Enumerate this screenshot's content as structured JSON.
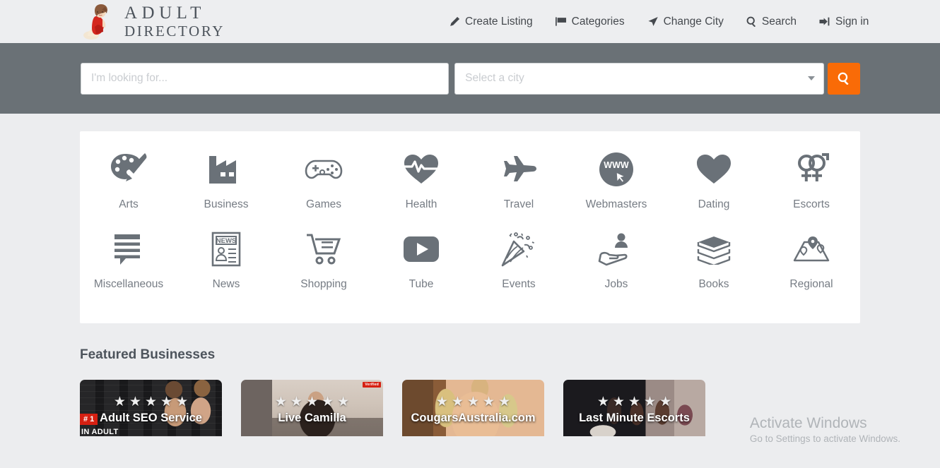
{
  "site": {
    "logo_line1": "ADULT",
    "logo_line2": "DIRECTORY"
  },
  "nav": {
    "items": [
      {
        "label": "Create Listing",
        "icon": "pencil-icon"
      },
      {
        "label": "Categories",
        "icon": "flag-icon"
      },
      {
        "label": "Change City",
        "icon": "location-arrow-icon"
      },
      {
        "label": "Search",
        "icon": "search-icon"
      },
      {
        "label": "Sign in",
        "icon": "sign-in-icon"
      }
    ]
  },
  "search": {
    "query_value": "",
    "query_placeholder": "I'm looking for...",
    "city_value": "Select a city",
    "submit_icon": "search-icon",
    "band_color": "#6a7176",
    "button_color": "#f96b07"
  },
  "categories": {
    "row1": [
      {
        "label": "Arts",
        "icon": "palette-icon"
      },
      {
        "label": "Business",
        "icon": "factory-icon"
      },
      {
        "label": "Games",
        "icon": "gamepad-icon"
      },
      {
        "label": "Health",
        "icon": "heartbeat-icon"
      },
      {
        "label": "Travel",
        "icon": "airplane-icon"
      },
      {
        "label": "Webmasters",
        "icon": "www-circle-icon"
      },
      {
        "label": "Dating",
        "icon": "heart-icon"
      },
      {
        "label": "Escorts",
        "icon": "gender-symbols-icon"
      }
    ],
    "row2": [
      {
        "label": "Miscellaneous",
        "icon": "speech-bubble-icon"
      },
      {
        "label": "News",
        "icon": "newspaper-icon"
      },
      {
        "label": "Shopping",
        "icon": "shopping-cart-icon"
      },
      {
        "label": "Tube",
        "icon": "play-button-icon"
      },
      {
        "label": "Events",
        "icon": "party-popper-icon"
      },
      {
        "label": "Jobs",
        "icon": "hand-person-icon"
      },
      {
        "label": "Books",
        "icon": "books-stack-icon"
      },
      {
        "label": "Regional",
        "icon": "map-pins-icon"
      }
    ]
  },
  "featured": {
    "heading": "Featured Businesses",
    "cards": [
      {
        "name": "Adult SEO Service",
        "rating": 5,
        "rank_badge": "# 1",
        "sub_badge": "IN ADULT",
        "corner_badge": ""
      },
      {
        "name": "Live Camilla",
        "rating": 5,
        "rank_badge": "",
        "sub_badge": "",
        "corner_badge": "Verified"
      },
      {
        "name": "CougarsAustralia.com",
        "rating": 5,
        "rank_badge": "",
        "sub_badge": "",
        "corner_badge": ""
      },
      {
        "name": "Last Minute Escorts",
        "rating": 5,
        "rank_badge": "",
        "sub_badge": "",
        "corner_badge": ""
      }
    ]
  },
  "watermark": {
    "line1": "Activate Windows",
    "line2": "Go to Settings to activate Windows."
  }
}
